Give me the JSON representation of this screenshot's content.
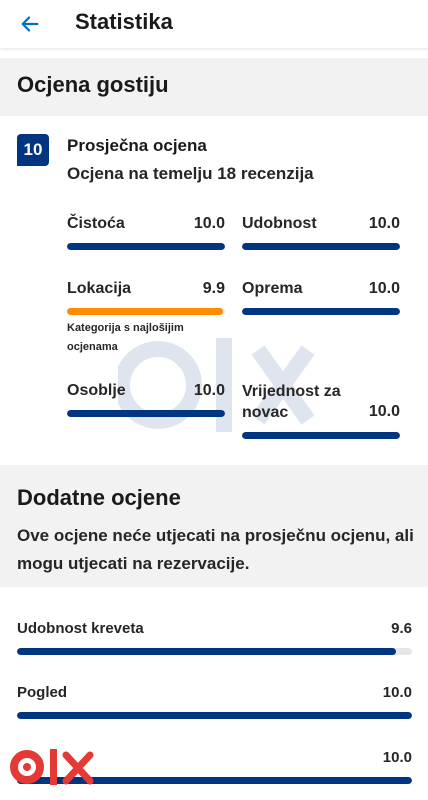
{
  "header": {
    "title": "Statistika",
    "back_icon": "arrow-left-icon"
  },
  "guest_rating": {
    "section_title": "Ocjena gostiju",
    "score": "10",
    "average_title": "Prosječna ocjena",
    "average_subtitle": "Ocjena na temelju 18 recenzija",
    "categories": [
      {
        "label": "Čistoća",
        "value": "10.0",
        "fill": 1.0
      },
      {
        "label": "Udobnost",
        "value": "10.0",
        "fill": 1.0
      },
      {
        "label": "Lokacija",
        "value": "9.9",
        "fill": 0.99,
        "note": "Kategorija s najlošijim ocjenama"
      },
      {
        "label": "Oprema",
        "value": "10.0",
        "fill": 1.0
      },
      {
        "label": "Osoblje",
        "value": "10.0",
        "fill": 1.0
      },
      {
        "label": "Vrijednost za novac",
        "value": "10.0",
        "fill": 1.0
      }
    ]
  },
  "additional": {
    "section_title": "Dodatne ocjene",
    "description": "Ove ocjene neće utjecati na prosječnu ocjenu, ali mogu utjecati na rezervacije.",
    "rows": [
      {
        "label": "Udobnost kreveta",
        "value": "9.6",
        "fill": 0.96
      },
      {
        "label": "Pogled",
        "value": "10.0",
        "fill": 1.0
      },
      {
        "label": "",
        "value": "10.0",
        "fill": 1.0
      }
    ]
  },
  "colors": {
    "primary": "#003580",
    "accent": "#ff8c00",
    "back_arrow": "#0071c2",
    "brand_red": "#e53935"
  },
  "brand": {
    "logo": "olx-logo"
  }
}
